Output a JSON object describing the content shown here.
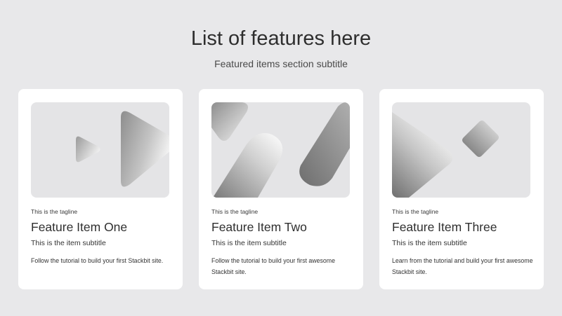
{
  "section": {
    "title": "List of features here",
    "subtitle": "Featured items section subtitle"
  },
  "features": [
    {
      "tagline": "This is the tagline",
      "title": "Feature Item One",
      "subtitle": "This is the item subtitle",
      "text": "Follow the tutorial to build your first Stackbit site.",
      "image_icon": "play-shapes-illustration"
    },
    {
      "tagline": "This is the tagline",
      "title": "Feature Item Two",
      "subtitle": "This is the item subtitle",
      "text": "Follow the tutorial to build your first awesome Stackbit site.",
      "image_icon": "slanted-shapes-illustration"
    },
    {
      "tagline": "This is the tagline",
      "title": "Feature Item Three",
      "subtitle": "This is the item subtitle",
      "text": "Learn from the tutorial and build your first awesome Stackbit site.",
      "image_icon": "triangle-cube-illustration"
    }
  ],
  "colors": {
    "page_background": "#e8e8ea",
    "card_background": "#ffffff",
    "image_background": "#e4e4e6",
    "text": "#2e2e2e"
  }
}
